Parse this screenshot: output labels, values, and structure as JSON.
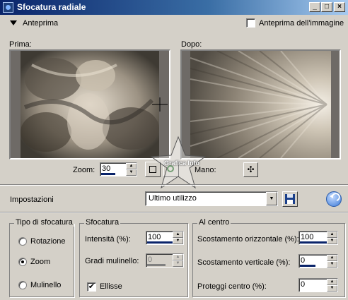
{
  "window": {
    "title": "Sfocatura radiale",
    "minimize_glyph": "_",
    "maximize_glyph": "□",
    "close_glyph": "×"
  },
  "preview": {
    "toggle_label": "Anteprima",
    "image_preview_label": "Anteprima dell'immagine",
    "image_preview_checked": false,
    "before_label": "Prima:",
    "after_label": "Dopo:",
    "zoom_label": "Zoom:",
    "zoom_value": "30",
    "hand_label": "Mano:"
  },
  "settings": {
    "label": "Impostazioni",
    "preset": "Ultimo utilizzo"
  },
  "blur_type": {
    "legend": "Tipo di sfocatura",
    "options": [
      "Rotazione",
      "Zoom",
      "Mulinello"
    ],
    "selected": "Zoom"
  },
  "blur": {
    "legend": "Sfocatura",
    "intensity_label": "Intensità (%):",
    "intensity_value": "100",
    "intensity_fill": 1.0,
    "swirl_label": "Gradi mulinello:",
    "swirl_value": "0",
    "ellipse_label": "Ellisse",
    "ellipse_checked": true
  },
  "center": {
    "legend": "Al centro",
    "h_offset_label": "Scostamento orizzontale (%):",
    "h_offset_value": "100",
    "h_offset_fill": 1.0,
    "v_offset_label": "Scostamento verticale (%):",
    "v_offset_value": "0",
    "v_offset_fill": 0.5,
    "protect_label": "Proteggi centro (%):",
    "protect_value": "0"
  },
  "watermark": {
    "text": "Grafica Info"
  },
  "icons": {
    "toggle": "triangle-down-icon",
    "hand": "move-cross-icon",
    "save": "floppy-disk-icon",
    "reset": "undo-arrow-icon",
    "zoom_fit": "fit-window-icon",
    "zoom_actual": "magnifier-icon"
  },
  "colors": {
    "title_start": "#0a246a",
    "title_end": "#a6caf0",
    "face": "#d4d0c8",
    "selection": "#0a246a"
  }
}
